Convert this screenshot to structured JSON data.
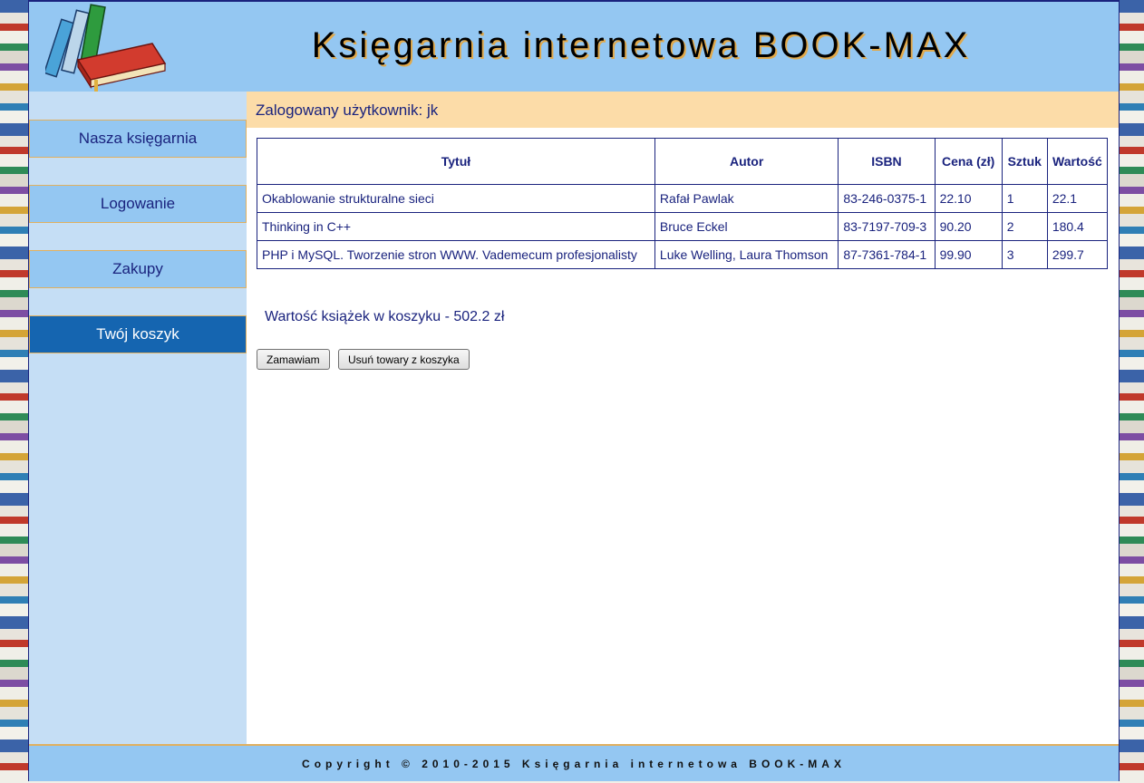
{
  "header": {
    "title": "Księgarnia internetowa BOOK-MAX",
    "logo_icon": "books-icon"
  },
  "sidebar": {
    "items": [
      {
        "label": "Nasza księgarnia",
        "active": false
      },
      {
        "label": "Logowanie",
        "active": false
      },
      {
        "label": "Zakupy",
        "active": false
      },
      {
        "label": "Twój koszyk",
        "active": true
      }
    ]
  },
  "main": {
    "user_bar": "Zalogowany użytkownik: jk",
    "table": {
      "headers": [
        "Tytuł",
        "Autor",
        "ISBN",
        "Cena (zł)",
        "Sztuk",
        "Wartość"
      ],
      "rows": [
        [
          "Okablowanie strukturalne sieci",
          "Rafał Pawlak",
          "83-246-0375-1",
          "22.10",
          "1",
          "22.1"
        ],
        [
          "Thinking in C++",
          "Bruce Eckel",
          "83-7197-709-3",
          "90.20",
          "2",
          "180.4"
        ],
        [
          "PHP i MySQL. Tworzenie stron WWW. Vademecum profesjonalisty",
          "Luke Welling, Laura Thomson",
          "87-7361-784-1",
          "99.90",
          "3",
          "299.7"
        ]
      ]
    },
    "total": "Wartość książek w koszyku - 502.2 zł",
    "buttons": {
      "order": "Zamawiam",
      "remove": "Usuń towary z koszyka"
    }
  },
  "footer": {
    "copyright": "Copyright © 2010-2015 Księgarnia internetowa BOOK-MAX"
  },
  "colors": {
    "header_bg": "#94c7f2",
    "sidebar_bg": "#c5def5",
    "active_nav": "#1565b0",
    "user_bar_bg": "#fcdca8",
    "text": "#1a237e"
  }
}
